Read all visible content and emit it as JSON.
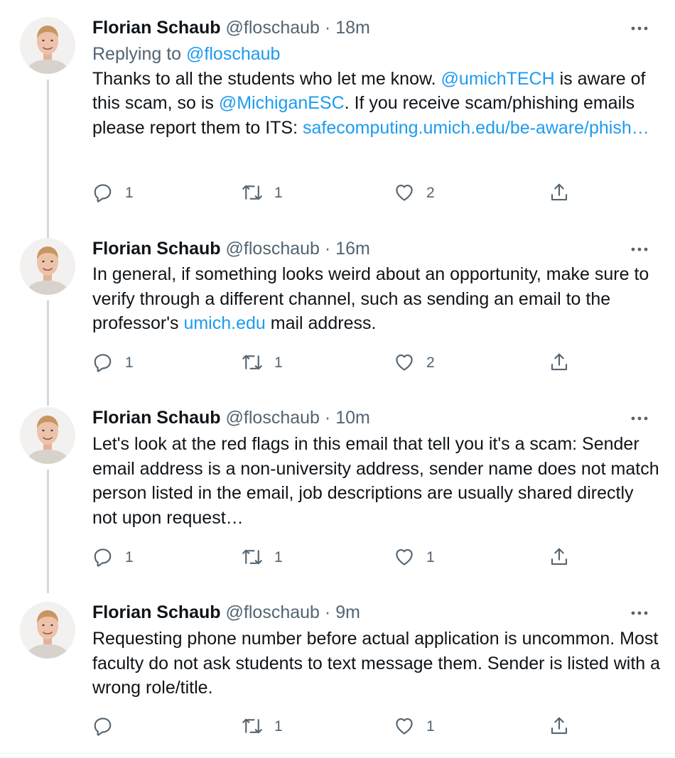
{
  "tweets": [
    {
      "name": "Florian Schaub",
      "handle": "@floschaub",
      "dot": "·",
      "time": "18m",
      "replying_prefix": "Replying to ",
      "replying_handle": "@floschaub",
      "segments": [
        {
          "text": "Thanks to all the students who let me know. ",
          "link": false
        },
        {
          "text": "@umichTECH",
          "link": true
        },
        {
          "text": " is aware of this scam, so is ",
          "link": false
        },
        {
          "text": "@MichiganESC",
          "link": true
        },
        {
          "text": ". If you receive scam/phishing emails please report them to ITS: ",
          "link": false
        },
        {
          "text": "safecomputing.umich.edu/be-aware/phish…",
          "link": true
        }
      ],
      "replies": "1",
      "retweets": "1",
      "likes": "2"
    },
    {
      "name": "Florian Schaub",
      "handle": "@floschaub",
      "dot": "·",
      "time": "16m",
      "segments": [
        {
          "text": "In general, if something looks weird about an opportunity, make sure to verify through a different channel, such as sending an email to the professor's ",
          "link": false
        },
        {
          "text": "umich.edu",
          "link": true
        },
        {
          "text": " mail address.",
          "link": false
        }
      ],
      "replies": "1",
      "retweets": "1",
      "likes": "2"
    },
    {
      "name": "Florian Schaub",
      "handle": "@floschaub",
      "dot": "·",
      "time": "10m",
      "segments": [
        {
          "text": "Let's look at the red flags in this email that tell you it's a scam: Sender email address is a non-university address, sender name does not match person listed in the email, job descriptions are usually shared directly not upon request…",
          "link": false
        }
      ],
      "replies": "1",
      "retweets": "1",
      "likes": "1"
    },
    {
      "name": "Florian Schaub",
      "handle": "@floschaub",
      "dot": "·",
      "time": "9m",
      "segments": [
        {
          "text": "Requesting phone number before actual application is uncommon. Most faculty do not ask students to text message them. Sender is listed with a wrong role/title.",
          "link": false
        }
      ],
      "replies": "",
      "retweets": "1",
      "likes": "1"
    }
  ],
  "icons": {
    "reply": "reply-icon",
    "retweet": "retweet-icon",
    "like": "like-icon",
    "share": "share-icon",
    "more": "more-icon",
    "avatar": "avatar"
  },
  "colors": {
    "link": "#1d9bf0",
    "secondary": "#536471",
    "text": "#0f1419",
    "thread_line": "#cfd9de"
  }
}
